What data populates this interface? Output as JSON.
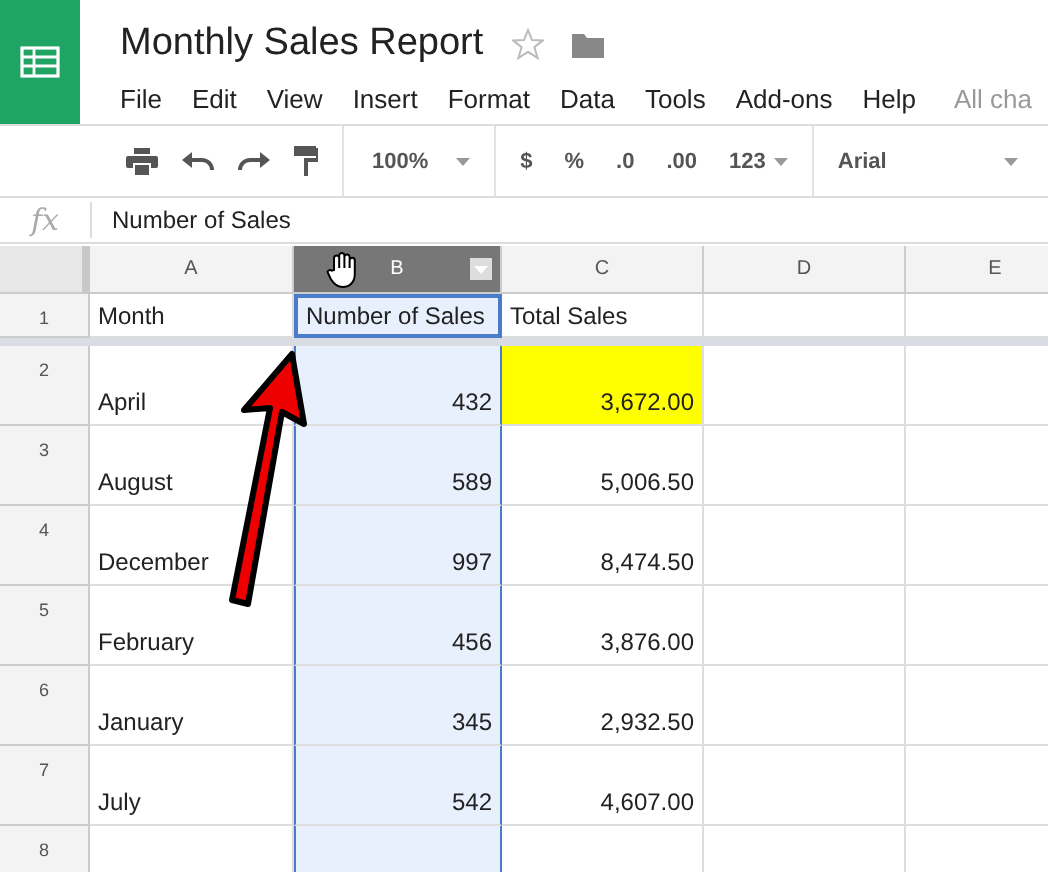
{
  "document": {
    "title": "Monthly Sales Report",
    "starred": false
  },
  "menu": [
    "File",
    "Edit",
    "View",
    "Insert",
    "Format",
    "Data",
    "Tools",
    "Add-ons",
    "Help"
  ],
  "last_edit": "All cha",
  "toolbar": {
    "zoom": "100%",
    "currency": "$",
    "percent": "%",
    "decrease_decimals": ".0",
    "increase_decimals": ".00",
    "more_formats": "123",
    "font": "Arial"
  },
  "formula_bar": {
    "label": "fx",
    "value": "Number of Sales"
  },
  "columns": [
    {
      "label": "A",
      "selected": false
    },
    {
      "label": "B",
      "selected": true
    },
    {
      "label": "C",
      "selected": false
    },
    {
      "label": "D",
      "selected": false
    },
    {
      "label": "E",
      "selected": false
    }
  ],
  "rows": [
    {
      "number": "1",
      "cells": [
        {
          "text": "Month",
          "kind": "text",
          "highlighted": false,
          "active": false
        },
        {
          "text": "Number of Sales",
          "kind": "text",
          "highlighted": false,
          "active": true
        },
        {
          "text": "Total Sales",
          "kind": "text",
          "highlighted": false,
          "active": false
        }
      ]
    },
    {
      "number": "2",
      "cells": [
        {
          "text": "April",
          "kind": "text",
          "highlighted": false,
          "active": false
        },
        {
          "text": "432",
          "kind": "number",
          "highlighted": false,
          "active": false
        },
        {
          "text": "3,672.00",
          "kind": "number",
          "highlighted": true,
          "active": false
        }
      ]
    },
    {
      "number": "3",
      "cells": [
        {
          "text": "August",
          "kind": "text",
          "highlighted": false,
          "active": false
        },
        {
          "text": "589",
          "kind": "number",
          "highlighted": false,
          "active": false
        },
        {
          "text": "5,006.50",
          "kind": "number",
          "highlighted": false,
          "active": false
        }
      ]
    },
    {
      "number": "4",
      "cells": [
        {
          "text": "December",
          "kind": "text",
          "highlighted": false,
          "active": false
        },
        {
          "text": "997",
          "kind": "number",
          "highlighted": false,
          "active": false
        },
        {
          "text": "8,474.50",
          "kind": "number",
          "highlighted": false,
          "active": false
        }
      ]
    },
    {
      "number": "5",
      "cells": [
        {
          "text": "February",
          "kind": "text",
          "highlighted": false,
          "active": false
        },
        {
          "text": "456",
          "kind": "number",
          "highlighted": false,
          "active": false
        },
        {
          "text": "3,876.00",
          "kind": "number",
          "highlighted": false,
          "active": false
        }
      ]
    },
    {
      "number": "6",
      "cells": [
        {
          "text": "January",
          "kind": "text",
          "highlighted": false,
          "active": false
        },
        {
          "text": "345",
          "kind": "number",
          "highlighted": false,
          "active": false
        },
        {
          "text": "2,932.50",
          "kind": "number",
          "highlighted": false,
          "active": false
        }
      ]
    },
    {
      "number": "7",
      "cells": [
        {
          "text": "July",
          "kind": "text",
          "highlighted": false,
          "active": false
        },
        {
          "text": "542",
          "kind": "number",
          "highlighted": false,
          "active": false
        },
        {
          "text": "4,607.00",
          "kind": "number",
          "highlighted": false,
          "active": false
        }
      ]
    },
    {
      "number": "8"
    }
  ]
}
